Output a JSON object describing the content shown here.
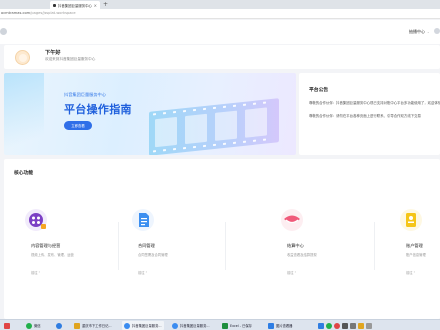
{
  "browser": {
    "tab_title": "抖音集团巨量服务中心",
    "tab_close": "×",
    "new_tab": "+",
    "url_host": "ocmtramas.com",
    "url_path": "/pages/jssplat-workspace"
  },
  "header": {
    "user_menu_label": "抽播中心",
    "user_menu_chevron": "⌄"
  },
  "greeting": {
    "title": "下午好",
    "subtitle": "欢迎来到抖音集团巨量服务中心"
  },
  "banner": {
    "subtitle": "抖音集团巨量服务中心",
    "title": "平台操作指南",
    "button_label": "立即查看",
    "colors": {
      "accent": "#1e5fdc",
      "button": "#2f6fe8"
    }
  },
  "announcements": {
    "title": "平台公告",
    "items": [
      "尊敬的合作伙伴：抖音集团巨量服务中心现已支持对账中心平台多功能使用了，欢迎体验",
      "尊敬的合作伙伴：请勿在平台各种页面上进行联系、引导合作双方线下交易"
    ]
  },
  "core": {
    "title": "核心功能",
    "cards": [
      {
        "name": "内容管理与经营",
        "desc": "视频上传、发布、管理、运营",
        "link": "前往",
        "icon": "video-icon",
        "color": "#7b3fc4"
      },
      {
        "name": "合同管理",
        "desc": "合同签署及合同管理",
        "link": "前往",
        "icon": "document-icon",
        "color": "#3c8ff0"
      },
      {
        "name": "结算中心",
        "desc": "收益查看及结算提现",
        "link": "前往",
        "icon": "wallet-icon",
        "color": "#f05a7a"
      },
      {
        "name": "账户管理",
        "desc": "账户信息管理",
        "link": "前往",
        "icon": "account-icon",
        "color": "#f5c518"
      }
    ]
  },
  "taskbar": {
    "items": [
      {
        "label": "",
        "icon": "start-icon",
        "color": "#e04545"
      },
      {
        "label": "微信",
        "icon": "wechat-icon",
        "color": "#21b04b"
      },
      {
        "label": "",
        "icon": "browser-icon",
        "color": "#2f7de1"
      },
      {
        "label": "重庆市下工作日记...",
        "icon": "explorer-icon",
        "color": "#e0a520"
      },
      {
        "label": "抖音集团巨量服务...",
        "icon": "chrome-icon",
        "color": "#3b8cf0"
      },
      {
        "label": "抖音集团巨量服务...",
        "icon": "chrome-icon",
        "color": "#3b8cf0"
      },
      {
        "label": "Excel - 已保存",
        "icon": "excel-icon",
        "color": "#1e8e3e"
      },
      {
        "label": "图片查看器",
        "icon": "image-icon",
        "color": "#2d7de4"
      }
    ]
  }
}
